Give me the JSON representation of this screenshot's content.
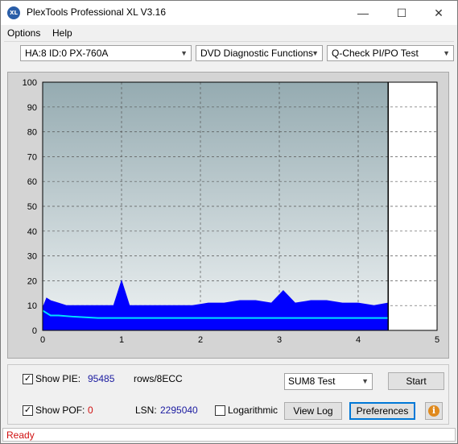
{
  "app": {
    "icon_text": "XL",
    "title": "PlexTools Professional XL V3.16"
  },
  "window_controls": {
    "minimize": "—",
    "maximize": "☐",
    "close": "✕"
  },
  "menu": {
    "options": "Options",
    "help": "Help"
  },
  "toolbar": {
    "drive": "HA:8 ID:0  PX-760A",
    "function": "DVD Diagnostic Functions",
    "test": "Q-Check PI/PO Test"
  },
  "chart_data": {
    "type": "area",
    "title": "",
    "xlabel": "",
    "ylabel": "",
    "xlim": [
      0,
      5
    ],
    "ylim": [
      0,
      100
    ],
    "x_ticks": [
      "0",
      "1",
      "2",
      "3",
      "4",
      "5"
    ],
    "y_ticks": [
      "0",
      "10",
      "20",
      "30",
      "40",
      "50",
      "60",
      "70",
      "80",
      "90",
      "100"
    ],
    "grid": true,
    "scan_end_x": 4.38,
    "series": [
      {
        "color": "#0000ff",
        "x": [
          0,
          0.05,
          0.1,
          0.2,
          0.3,
          0.5,
          0.7,
          0.9,
          1.0,
          1.1,
          1.3,
          1.5,
          1.7,
          1.9,
          2.1,
          2.3,
          2.5,
          2.7,
          2.9,
          3.05,
          3.2,
          3.4,
          3.6,
          3.8,
          4.0,
          4.2,
          4.38
        ],
        "y": [
          9,
          13,
          12,
          11,
          10,
          10,
          10,
          10,
          20,
          10,
          10,
          10,
          10,
          10,
          11,
          11,
          12,
          12,
          11,
          16,
          11,
          12,
          12,
          11,
          11,
          10,
          11
        ]
      },
      {
        "color": "#00e0ff",
        "x": [
          0,
          0.05,
          0.1,
          0.2,
          0.4,
          0.7,
          1.0,
          1.5,
          2.0,
          2.5,
          3.0,
          3.5,
          4.0,
          4.38
        ],
        "y": [
          8,
          7,
          6,
          6,
          5.5,
          5,
          5,
          5,
          5,
          5,
          5,
          5,
          5,
          5
        ]
      }
    ]
  },
  "panel": {
    "show_pie_label": "Show PIE:",
    "pie_value": "95485",
    "rows_label": "rows/8ECC",
    "show_pof_label": "Show POF:",
    "pof_value": "0",
    "lsn_label": "LSN:",
    "lsn_value": "2295040",
    "logarithmic_label": "Logarithmic",
    "sum_test": "SUM8 Test",
    "start_label": "Start",
    "view_log_label": "View Log",
    "preferences_label": "Preferences",
    "info_icon_text": "i"
  },
  "status": {
    "text": "Ready"
  }
}
